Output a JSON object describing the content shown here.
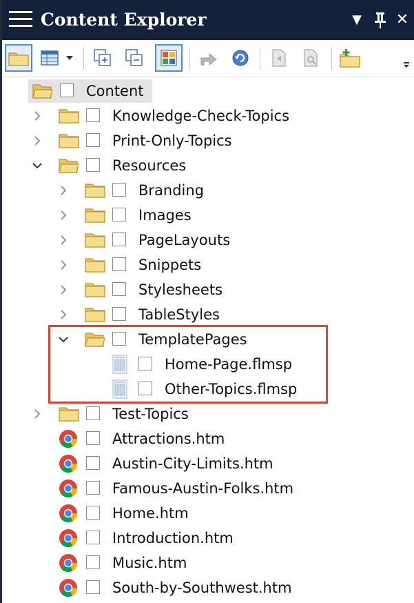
{
  "window": {
    "title": "Content Explorer",
    "menu_icon": "hamburger-menu-icon",
    "buttons": {
      "dropdown": "▼",
      "pin": "ᵖ",
      "close": "✕"
    }
  },
  "toolbar": {
    "items": [
      {
        "name": "show-files-button",
        "icon": "folder-icon",
        "pressed": true
      },
      {
        "name": "view-options-button",
        "icon": "grid-view-icon",
        "pressed": false
      },
      {
        "name": "expand-all-button",
        "icon": "expand-all-icon",
        "pressed": false
      },
      {
        "name": "collapse-all-button",
        "icon": "collapse-all-icon",
        "pressed": false
      },
      {
        "name": "color-squares-button",
        "icon": "color-grid-icon",
        "pressed": true
      },
      {
        "name": "move-button",
        "icon": "arrow-icon",
        "pressed": false
      },
      {
        "name": "refresh-button",
        "icon": "refresh-icon",
        "pressed": false
      },
      {
        "name": "open-button",
        "icon": "document-icon",
        "pressed": false
      },
      {
        "name": "properties-button",
        "icon": "document-properties-icon",
        "pressed": false
      },
      {
        "name": "new-folder-button",
        "icon": "new-folder-icon",
        "pressed": false
      }
    ],
    "overflow_icon": "toolbar-overflow-icon"
  },
  "tree": {
    "root": {
      "label": "Content"
    },
    "items": [
      {
        "label": "Knowledge-Check-Topics",
        "type": "folder",
        "expanded": false
      },
      {
        "label": "Print-Only-Topics",
        "type": "folder",
        "expanded": false
      },
      {
        "label": "Resources",
        "type": "folder",
        "expanded": true
      },
      {
        "label": "Branding",
        "type": "folder",
        "expanded": false
      },
      {
        "label": "Images",
        "type": "folder",
        "expanded": false
      },
      {
        "label": "PageLayouts",
        "type": "folder",
        "expanded": false
      },
      {
        "label": "Snippets",
        "type": "folder",
        "expanded": false
      },
      {
        "label": "Stylesheets",
        "type": "folder",
        "expanded": false
      },
      {
        "label": "TableStyles",
        "type": "folder",
        "expanded": false
      },
      {
        "label": "TemplatePages",
        "type": "folder",
        "expanded": true
      },
      {
        "label": "Home-Page.flmsp",
        "type": "template-file"
      },
      {
        "label": "Other-Topics.flmsp",
        "type": "template-file"
      },
      {
        "label": "Test-Topics",
        "type": "folder",
        "expanded": false
      },
      {
        "label": "Attractions.htm",
        "type": "html-file"
      },
      {
        "label": "Austin-City-Limits.htm",
        "type": "html-file"
      },
      {
        "label": "Famous-Austin-Folks.htm",
        "type": "html-file"
      },
      {
        "label": "Home.htm",
        "type": "html-file"
      },
      {
        "label": "Introduction.htm",
        "type": "html-file"
      },
      {
        "label": "Music.htm",
        "type": "html-file"
      },
      {
        "label": "South-by-Southwest.htm",
        "type": "html-file"
      }
    ]
  },
  "colors": {
    "titlebar": "#14213a",
    "highlight": "#e0452b",
    "folder": "#f2d27a",
    "selection": "#e4e4e4"
  }
}
